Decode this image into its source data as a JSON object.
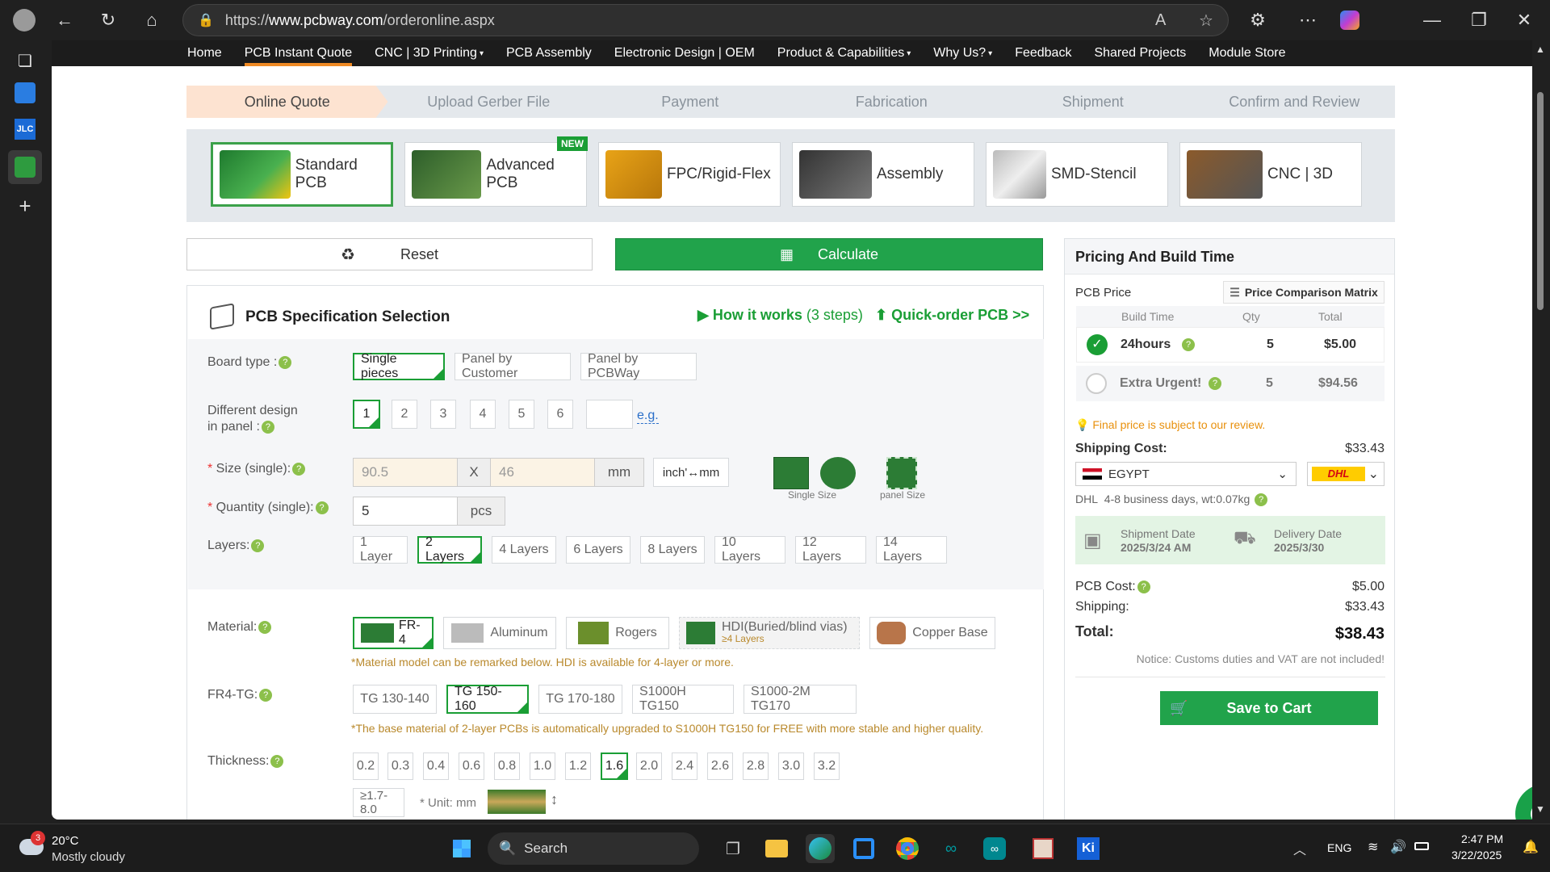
{
  "browser": {
    "url_prefix": "https://",
    "url_domain": "www.pcbway.com",
    "url_path": "/orderonline.aspx"
  },
  "nav": [
    "Home",
    "PCB Instant Quote",
    "CNC | 3D Printing",
    "PCB Assembly",
    "Electronic Design | OEM",
    "Product & Capabilities",
    "Why Us?",
    "Feedback",
    "Shared Projects",
    "Module Store"
  ],
  "steps": [
    "Online Quote",
    "Upload Gerber File",
    "Payment",
    "Fabrication",
    "Shipment",
    "Confirm and Review"
  ],
  "products": [
    "Standard PCB",
    "Advanced PCB",
    "FPC/Rigid-Flex",
    "Assembly",
    "SMD-Stencil",
    "CNC | 3D"
  ],
  "new_badge": "NEW",
  "actions": {
    "reset": "Reset",
    "calculate": "Calculate"
  },
  "spec": {
    "title": "PCB Specification Selection",
    "how_it_works": "How it works",
    "how_steps": "(3 steps)",
    "quick_order": "Quick-order PCB >>",
    "board_type_label": "Board type :",
    "board_types": [
      "Single pieces",
      "Panel by Customer",
      "Panel by PCBWay"
    ],
    "diff_design_label1": "Different design",
    "diff_design_label2": "in panel :",
    "designs": [
      "1",
      "2",
      "3",
      "4",
      "5",
      "6"
    ],
    "eg": "e.g.",
    "size_label": "Size (single):",
    "size_x": "90.5",
    "size_sep": "X",
    "size_y": "46",
    "size_unit": "mm",
    "unit_toggle": "inch'↔mm",
    "single_size": "Single Size",
    "panel_size": "panel Size",
    "qty_label": "Quantity (single):",
    "qty": "5",
    "qty_unit": "pcs",
    "layers_label": "Layers:",
    "layers": [
      "1 Layer",
      "2 Layers",
      "4 Layers",
      "6 Layers",
      "8 Layers",
      "10 Layers",
      "12 Layers",
      "14 Layers"
    ],
    "material_label": "Material:",
    "materials": [
      "FR-4",
      "Aluminum",
      "Rogers",
      "HDI(Buried/blind vias)",
      "Copper Base"
    ],
    "hdi_sub": "≥4 Layers",
    "material_note": "*Material model can be remarked below. HDI is available for 4-layer or more.",
    "tg_label": "FR4-TG:",
    "tgs": [
      "TG 130-140",
      "TG 150-160",
      "TG 170-180",
      "S1000H TG150",
      "S1000-2M TG170"
    ],
    "tg_note": "*The base material of 2-layer PCBs is automatically upgraded to S1000H TG150 for FREE with more stable and higher quality.",
    "thickness_label": "Thickness:",
    "thicknesses": [
      "0.2",
      "0.3",
      "0.4",
      "0.6",
      "0.8",
      "1.0",
      "1.2",
      "1.6",
      "2.0",
      "2.4",
      "2.6",
      "2.8",
      "3.0",
      "3.2"
    ],
    "thick_extra": "≥1.7-8.0",
    "thick_unit": "* Unit: mm"
  },
  "pricing": {
    "title": "Pricing And Build Time",
    "pcb_price": "PCB Price",
    "matrix": "Price Comparison Matrix",
    "col_build": "Build Time",
    "col_qty": "Qty",
    "col_total": "Total",
    "rows": [
      {
        "time": "24hours",
        "qty": "5",
        "total": "$5.00"
      },
      {
        "time": "Extra Urgent!",
        "qty": "5",
        "total": "$94.56"
      }
    ],
    "final_note": "Final price is subject to our review.",
    "shipping_cost_label": "Shipping Cost:",
    "shipping_cost": "$33.43",
    "country": "EGYPT",
    "carrier": "DHL",
    "delivery_info": "4-8 business days, wt:0.07kg",
    "shipment_date_label": "Shipment Date",
    "shipment_date": "2025/3/24 AM",
    "delivery_date_label": "Delivery Date",
    "delivery_date": "2025/3/30",
    "pcb_cost_label": "PCB Cost:",
    "pcb_cost": "$5.00",
    "shipping_label": "Shipping:",
    "shipping": "$33.43",
    "total_label": "Total:",
    "total": "$38.43",
    "notice": "Notice: Customs duties and VAT are not included!",
    "save_to_cart": "Save to Cart"
  },
  "taskbar": {
    "weather_temp": "20°C",
    "weather_desc": "Mostly cloudy",
    "weather_badge": "3",
    "search": "Search",
    "lang": "ENG",
    "time": "2:47 PM",
    "date": "3/22/2025"
  },
  "sidebar_jlc": "JLC",
  "colors": {
    "accent_green": "#21a34b",
    "accent_orange": "#f08a24",
    "note_gold": "#b9892c"
  }
}
